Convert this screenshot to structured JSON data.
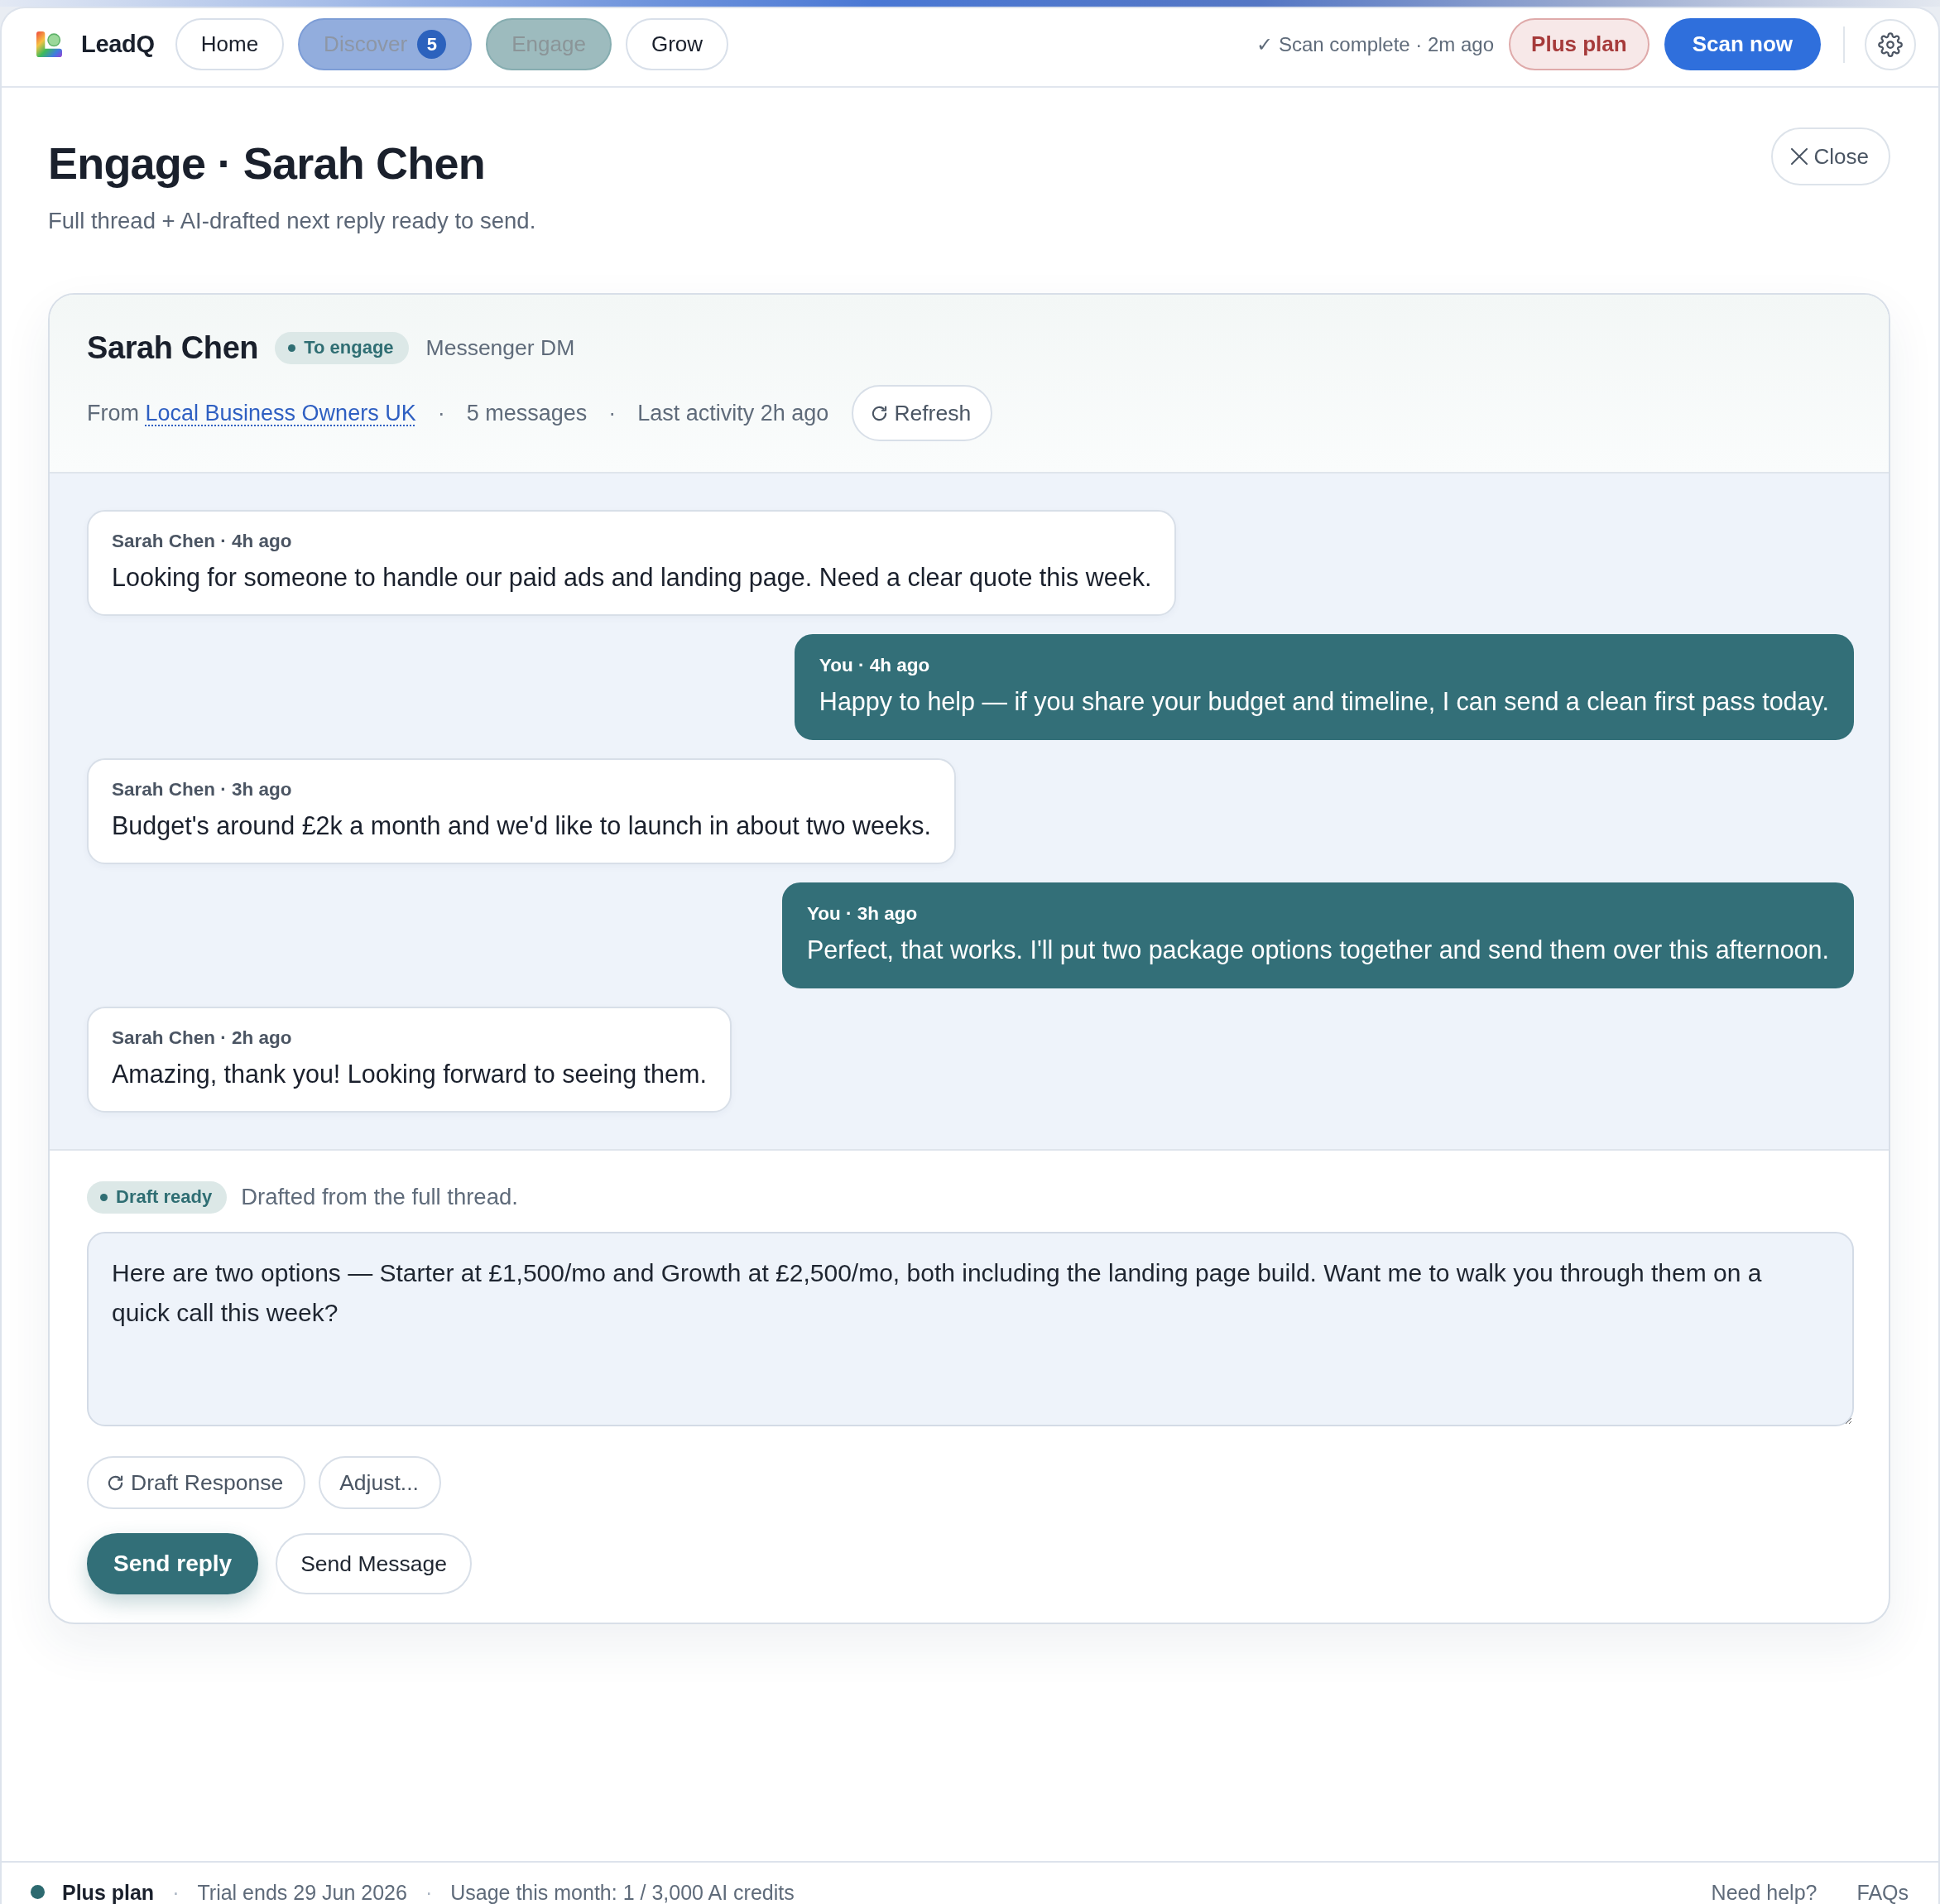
{
  "nav": {
    "logo": "LeadQ",
    "tabs": [
      {
        "label": "Home",
        "selected": false,
        "highlighted": false
      },
      {
        "label": "Discover",
        "badge": "5",
        "selected": false,
        "highlighted": true
      },
      {
        "label": "Engage",
        "selected": true,
        "highlighted": false
      },
      {
        "label": "Grow",
        "selected": false,
        "highlighted": false
      }
    ],
    "scan_status": "✓ Scan complete · 2m ago",
    "plan_button": "Plus plan",
    "scan_button": "Scan now"
  },
  "page": {
    "title": "Engage · Sarah Chen",
    "subtitle": "Full thread + AI-drafted next reply ready to send.",
    "close_button": "Close"
  },
  "contact": {
    "name": "Sarah Chen",
    "status": "To engage",
    "channel": "Messenger DM",
    "details": [
      {
        "kind": "source",
        "prefix": "From",
        "link": "Local Business Owners UK"
      },
      {
        "kind": "separator",
        "text": "·"
      },
      {
        "kind": "text",
        "text": "5 messages"
      },
      {
        "kind": "separator",
        "text": "·"
      },
      {
        "kind": "text",
        "text": "Last activity 2h ago"
      }
    ],
    "refresh_button": "Refresh"
  },
  "messages": [
    {
      "kind": "received",
      "meta": "Sarah Chen · 4h ago",
      "text": "Looking for someone to handle our paid ads and landing page. Need a clear quote this week."
    },
    {
      "kind": "sent",
      "meta": "You · 4h ago",
      "text": "Happy to help — if you share your budget and timeline, I can send a clean first pass today."
    },
    {
      "kind": "received",
      "meta": "Sarah Chen · 3h ago",
      "text": "Budget's around £2k a month and we'd like to launch in about two weeks."
    },
    {
      "kind": "sent",
      "meta": "You · 3h ago",
      "text": "Perfect, that works. I'll put two package options together and send them over this afternoon."
    },
    {
      "kind": "received",
      "meta": "Sarah Chen · 2h ago",
      "text": "Amazing, thank you! Looking forward to seeing them."
    }
  ],
  "draft": {
    "status": "Draft ready",
    "note": "Drafted from the full thread.",
    "value": "Here are two options — Starter at £1,500/mo and Growth at £2,500/mo, both including the landing page build. Want me to walk you through them on a quick call this week?",
    "tools": [
      {
        "label": "Draft Response",
        "kind": "regenerate"
      },
      {
        "label": "Adjust...",
        "kind": "plain"
      }
    ],
    "actions": [
      {
        "label": "Send reply",
        "kind": "primary"
      },
      {
        "label": "Send Message",
        "kind": "secondary"
      }
    ]
  },
  "footer": {
    "items": [
      {
        "kind": "plan",
        "text": "Plus plan"
      },
      {
        "kind": "separator",
        "text": "·"
      },
      {
        "kind": "text",
        "text": "Trial ends 29 Jun 2026"
      },
      {
        "kind": "separator",
        "text": "·"
      },
      {
        "kind": "text",
        "text": "Usage this month: 1 / 3,000 AI credits"
      }
    ],
    "links": [
      "Need help?",
      "FAQs"
    ]
  }
}
